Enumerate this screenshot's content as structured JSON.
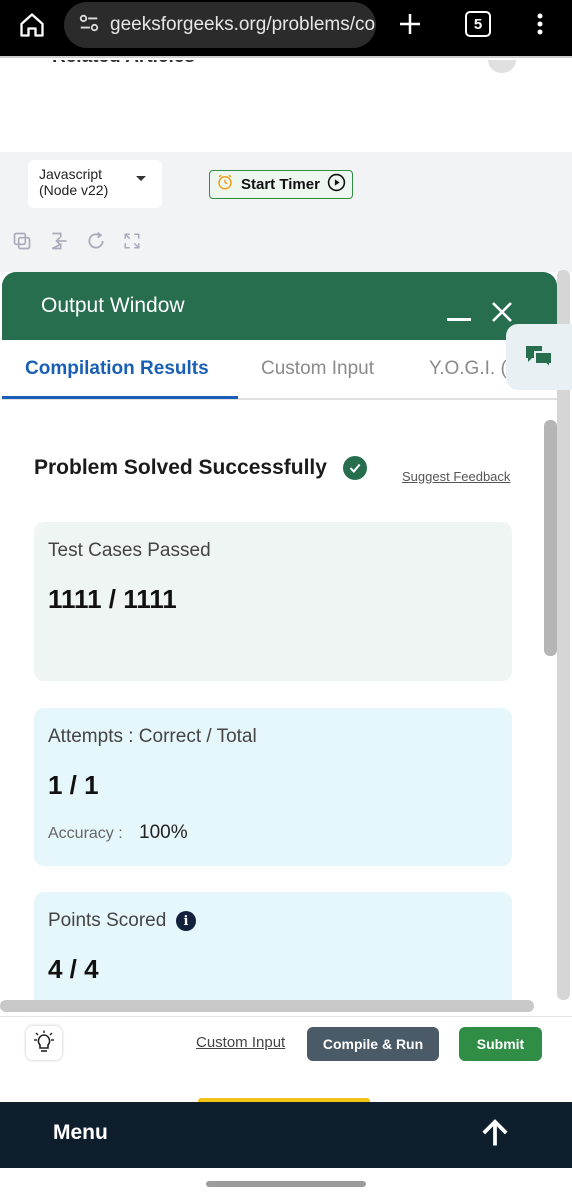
{
  "browser": {
    "url": "geeksforgeeks.org/problems/co",
    "tab_count": "5"
  },
  "page": {
    "related_articles": "Related Articles"
  },
  "editor": {
    "language_line1": "Javascript",
    "language_line2": "(Node v22)",
    "start_timer_label": "Start Timer"
  },
  "output_window": {
    "title": "Output Window",
    "tabs": [
      {
        "label": "Compilation Results",
        "active": true
      },
      {
        "label": "Custom Input",
        "active": false
      },
      {
        "label": "Y.O.G.I. (A",
        "active": false
      }
    ],
    "result_title": "Problem Solved Successfully",
    "suggest_feedback": "Suggest Feedback",
    "test_cases": {
      "label": "Test Cases Passed",
      "value": "1111 / 1111"
    },
    "attempts": {
      "label": "Attempts : Correct / Total",
      "value": "1 / 1",
      "accuracy_label": "Accuracy :",
      "accuracy_value": "100%"
    },
    "points": {
      "label": "Points Scored",
      "value": "4 / 4"
    }
  },
  "actions": {
    "custom_input": "Custom Input",
    "compile_run": "Compile & Run",
    "submit": "Submit"
  },
  "bottom_nav": {
    "menu": "Menu"
  },
  "colors": {
    "brand_green": "#276e4f",
    "tab_blue": "#1a5fb4",
    "submit_green": "#2f8d46",
    "compile_gray": "#4a5a66",
    "footer_navy": "#0f1e2c"
  },
  "icons": [
    "home-icon",
    "site-settings-icon",
    "plus-icon",
    "tab-switcher-icon",
    "more-vert-icon",
    "alarm-clock-icon",
    "play-circle-icon",
    "copy-icon",
    "import-icon",
    "reset-icon",
    "fullscreen-icon",
    "minimize-icon",
    "close-icon",
    "chat-icon",
    "check-circle-icon",
    "info-icon",
    "lightbulb-icon",
    "arrow-up-icon"
  ]
}
